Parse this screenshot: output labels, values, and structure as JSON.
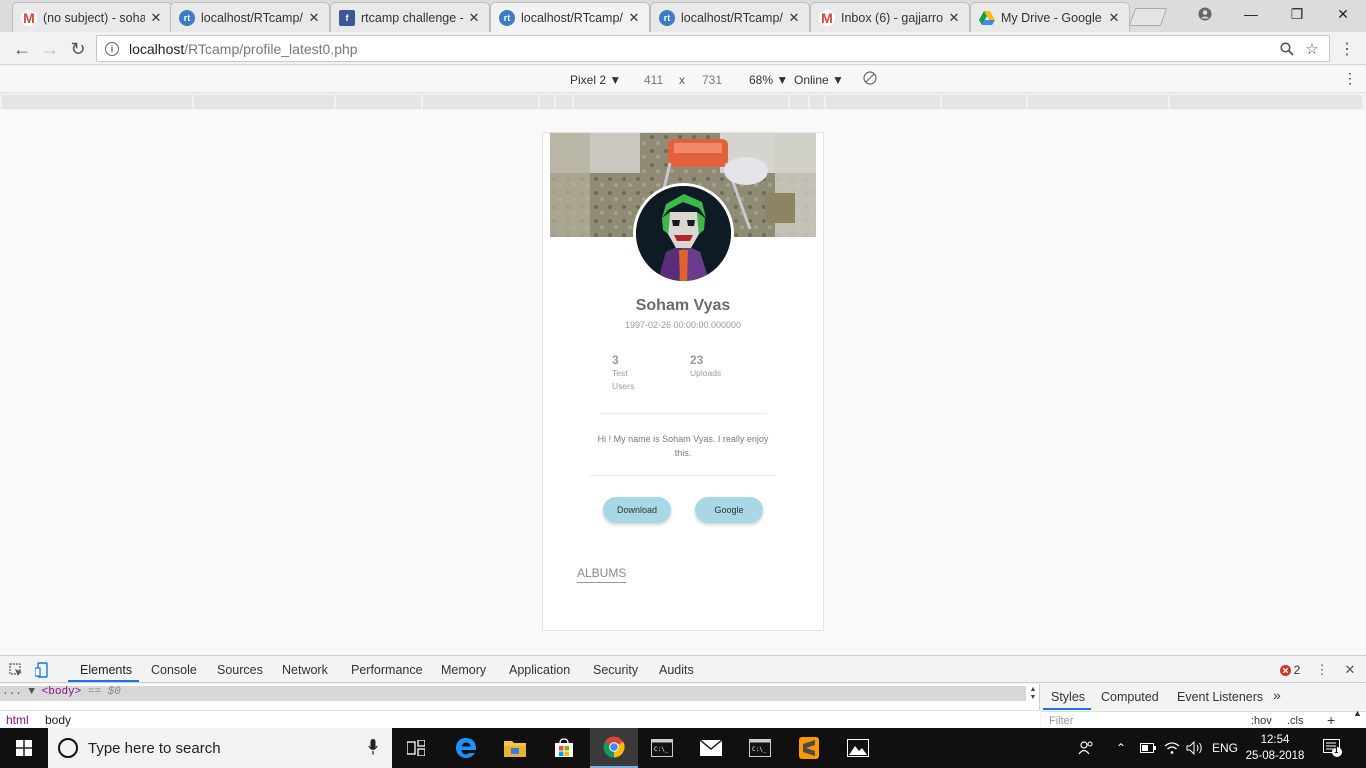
{
  "browser": {
    "tabs": [
      {
        "title": "(no subject) - soha",
        "icon": "gmail-icon",
        "color": "#d44638"
      },
      {
        "title": "localhost/RTcamp/p",
        "icon": "rtcamp-icon",
        "color": "#3e7cc2"
      },
      {
        "title": "rtcamp challenge -",
        "icon": "facebook-icon",
        "color": "#3b5998"
      },
      {
        "title": "localhost/RTcamp/p",
        "icon": "rtcamp-icon",
        "color": "#3e7cc2"
      },
      {
        "title": "localhost/RTcamp/",
        "icon": "rtcamp-icon",
        "color": "#3e7cc2"
      },
      {
        "title": "Inbox (6) - gajjarro",
        "icon": "gmail-icon",
        "color": "#d44638"
      },
      {
        "title": "My Drive - Google",
        "icon": "google-drive-icon",
        "color": "#fbbc04"
      }
    ],
    "url_host": "localhost",
    "url_path": "/RTcamp/profile_latest0.php"
  },
  "device_toolbar": {
    "device": "Pixel 2 ▼",
    "width": "411",
    "times": "x",
    "height": "731",
    "zoom": "68% ▼",
    "network": "Online ▼"
  },
  "profile": {
    "name": "Soham Vyas",
    "date": "1997-02-26 00:00:00.000000",
    "stats": [
      {
        "num": "3",
        "label": "Test Users"
      },
      {
        "num": "23",
        "label": "Uploads"
      }
    ],
    "bio": "Hi ! My name is Soham Vyas. I really enjoy this.",
    "buttons": {
      "download": "Download",
      "google": "Google"
    },
    "albums": "ALBUMS"
  },
  "devtools": {
    "tabs": [
      "Elements",
      "Console",
      "Sources",
      "Network",
      "Performance",
      "Memory",
      "Application",
      "Security",
      "Audits"
    ],
    "error_count": "2",
    "dom_line_prefix": "...",
    "dom_tag": "<body>",
    "dom_suffix": "== $0",
    "breadcrumbs": [
      "html",
      "body"
    ],
    "side_tabs": [
      "Styles",
      "Computed",
      "Event Listeners"
    ],
    "more": "»",
    "filter_placeholder": "Filter",
    "filter_hov": ":hov",
    "filter_cls": ".cls",
    "filter_plus": "+"
  },
  "taskbar": {
    "search_placeholder": "Type here to search",
    "language": "ENG",
    "time": "12:54",
    "date": "25-08-2018",
    "notification_count": "1"
  }
}
